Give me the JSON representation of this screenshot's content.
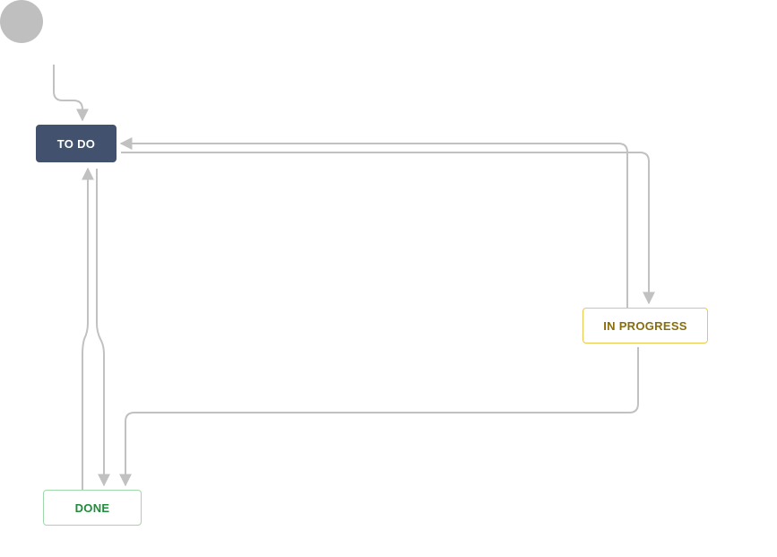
{
  "workflow": {
    "start": {
      "type": "initial"
    },
    "nodes": {
      "todo": {
        "label": "TO DO",
        "status_category": "todo"
      },
      "inprogress": {
        "label": "IN PROGRESS",
        "status_category": "in-progress"
      },
      "done": {
        "label": "DONE",
        "status_category": "done"
      }
    },
    "transitions": [
      {
        "from": "start",
        "to": "todo"
      },
      {
        "from": "todo",
        "to": "inprogress"
      },
      {
        "from": "inprogress",
        "to": "todo"
      },
      {
        "from": "todo",
        "to": "done"
      },
      {
        "from": "inprogress",
        "to": "done"
      },
      {
        "from": "done",
        "to": "todo"
      }
    ],
    "colors": {
      "connector": "#c1c1c1",
      "start_fill": "#bfbfbf",
      "todo_bg": "#42526E",
      "todo_fg": "#ffffff",
      "inprogress_border": "#e7c94f",
      "inprogress_fg": "#8a6d0b",
      "done_border": "#9fd8ab",
      "done_fg": "#1f8b3b"
    }
  }
}
